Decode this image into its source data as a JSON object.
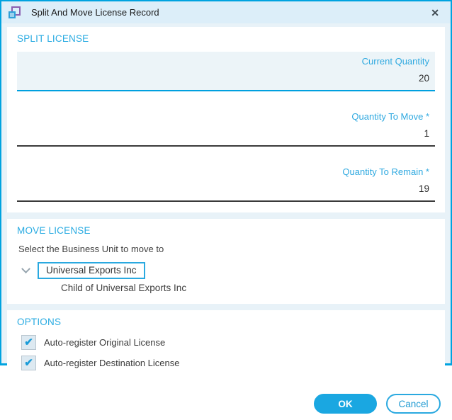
{
  "window": {
    "title": "Split And Move License Record",
    "close_glyph": "✕"
  },
  "split": {
    "header": "SPLIT LICENSE",
    "current_quantity": {
      "label": "Current Quantity",
      "value": "20"
    },
    "quantity_to_move": {
      "label": "Quantity To Move *",
      "value": "1"
    },
    "quantity_to_remain": {
      "label": "Quantity To Remain *",
      "value": "19"
    }
  },
  "move": {
    "header": "MOVE LICENSE",
    "instruction": "Select the Business Unit to move to",
    "tree": {
      "selected_node": "Universal Exports Inc",
      "child_node": "Child of Universal Exports Inc"
    }
  },
  "options": {
    "header": "OPTIONS",
    "check_glyph": "✔",
    "checkboxes": [
      {
        "label": "Auto-register Original License",
        "checked": true
      },
      {
        "label": "Auto-register Destination License",
        "checked": true
      }
    ]
  },
  "footer": {
    "ok_label": "OK",
    "cancel_label": "Cancel"
  },
  "colors": {
    "accent": "#29abe2",
    "window_border": "#00a3e0",
    "titlebar_bg": "#dceef9",
    "body_bg": "#e8f2f8",
    "readonly_field_bg": "#ecf4f8",
    "readonly_underline": "#00a0df",
    "editable_underline": "#3b3b3b",
    "check_color": "#1b9cd8",
    "text_dark": "#2b2b2b"
  }
}
